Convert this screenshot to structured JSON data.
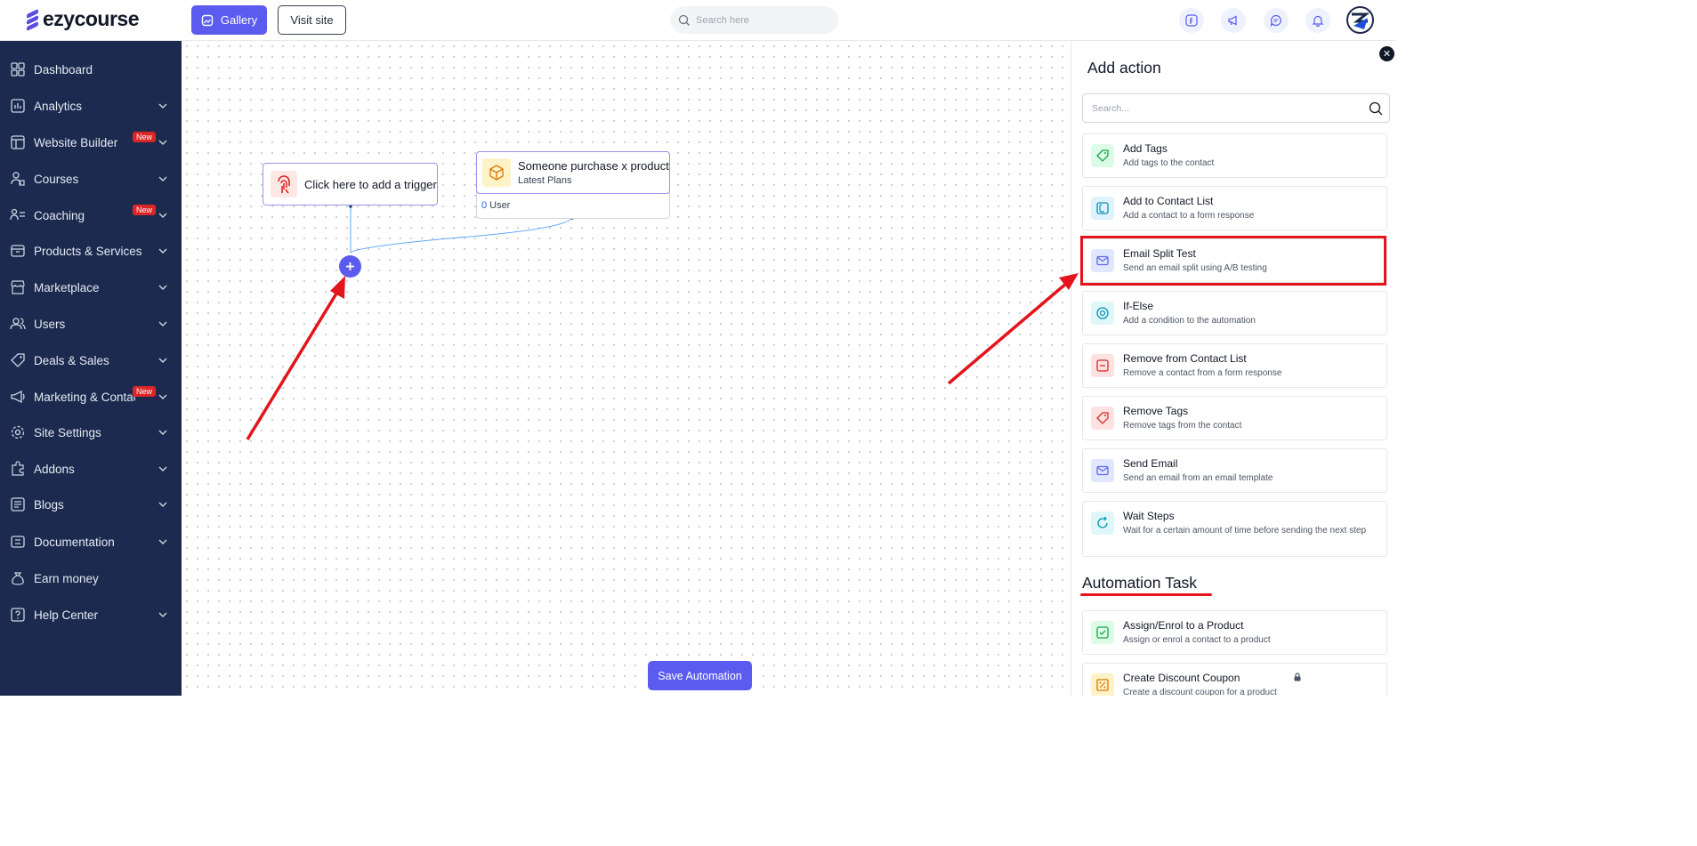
{
  "header": {
    "logo_text": "ezycourse",
    "gallery_label": "Gallery",
    "visit_label": "Visit site",
    "search_placeholder": "Search here"
  },
  "sidebar": {
    "items": [
      {
        "label": "Dashboard",
        "icon": "dashboard-icon",
        "chevron": false,
        "badge": ""
      },
      {
        "label": "Analytics",
        "icon": "analytics-icon",
        "chevron": true,
        "badge": ""
      },
      {
        "label": "Website Builder",
        "icon": "website-builder-icon",
        "chevron": true,
        "badge": "New"
      },
      {
        "label": "Courses",
        "icon": "courses-icon",
        "chevron": true,
        "badge": ""
      },
      {
        "label": "Coaching",
        "icon": "coaching-icon",
        "chevron": true,
        "badge": "New"
      },
      {
        "label": "Products & Services",
        "icon": "products-icon",
        "chevron": true,
        "badge": ""
      },
      {
        "label": "Marketplace",
        "icon": "marketplace-icon",
        "chevron": true,
        "badge": ""
      },
      {
        "label": "Users",
        "icon": "users-icon",
        "chevron": true,
        "badge": ""
      },
      {
        "label": "Deals & Sales",
        "icon": "tag-icon",
        "chevron": true,
        "badge": ""
      },
      {
        "label": "Marketing & Contacts",
        "icon": "marketing-icon",
        "chevron": true,
        "badge": "New"
      },
      {
        "label": "Site Settings",
        "icon": "settings-icon",
        "chevron": true,
        "badge": ""
      },
      {
        "label": "Addons",
        "icon": "addons-icon",
        "chevron": true,
        "badge": ""
      },
      {
        "label": "Blogs",
        "icon": "blogs-icon",
        "chevron": true,
        "badge": ""
      },
      {
        "label": "Documentation",
        "icon": "documentation-icon",
        "chevron": true,
        "badge": ""
      },
      {
        "label": "Earn money",
        "icon": "earn-money-icon",
        "chevron": false,
        "badge": ""
      },
      {
        "label": "Help Center",
        "icon": "help-icon",
        "chevron": true,
        "badge": ""
      }
    ]
  },
  "canvas": {
    "trigger_label": "Click here to add a trigger",
    "event_title": "Someone purchase x product",
    "event_subtitle": "Latest Plans",
    "event_count": "0",
    "event_count_label": "User",
    "save_label": "Save Automation"
  },
  "panel": {
    "title": "Add action",
    "search_placeholder": "Search...",
    "actions": [
      {
        "title": "Add Tags",
        "desc": "Add tags to the contact",
        "icon": "tag-icon",
        "color": "#16a34a",
        "bg": "#dcfce7"
      },
      {
        "title": "Add to Contact List",
        "desc": "Add a contact to a form response",
        "icon": "contact-list-icon",
        "color": "#0891b2",
        "bg": "#e0f2fe"
      },
      {
        "title": "Email Split Test",
        "desc": "Send an email split using A/B testing",
        "icon": "mail-icon",
        "color": "#6366f1",
        "bg": "#e0e7ff"
      },
      {
        "title": "If-Else",
        "desc": "Add a condition to the automation",
        "icon": "condition-icon",
        "color": "#0891b2",
        "bg": "#e0f7fa"
      },
      {
        "title": "Remove from Contact List",
        "desc": "Remove a contact from a form response",
        "icon": "remove-contact-icon",
        "color": "#dc2626",
        "bg": "#fee2e2"
      },
      {
        "title": "Remove Tags",
        "desc": "Remove tags from the contact",
        "icon": "remove-tag-icon",
        "color": "#dc2626",
        "bg": "#fee2e2"
      },
      {
        "title": "Send Email",
        "desc": "Send an email from an email template",
        "icon": "mail-icon",
        "color": "#6366f1",
        "bg": "#e0e7ff"
      },
      {
        "title": "Wait Steps",
        "desc": "Wait for a certain amount of time before sending the next step",
        "icon": "wait-icon",
        "color": "#0891b2",
        "bg": "#e0f7fa"
      }
    ],
    "task_title": "Automation Task",
    "tasks": [
      {
        "title": "Assign/Enrol to a Product",
        "desc": "Assign or enrol a contact to a product",
        "icon": "assign-product-icon",
        "color": "#16a34a",
        "bg": "#dcfce7"
      },
      {
        "title": "Create Discount Coupon",
        "desc": "Create a discount coupon for a product",
        "icon": "coupon-icon",
        "color": "#d97706",
        "bg": "#fef3c7"
      }
    ]
  },
  "colors": {
    "primary": "#5b5bf0",
    "sidebar_bg": "#1b2a4e",
    "highlight": "#e3141b"
  }
}
